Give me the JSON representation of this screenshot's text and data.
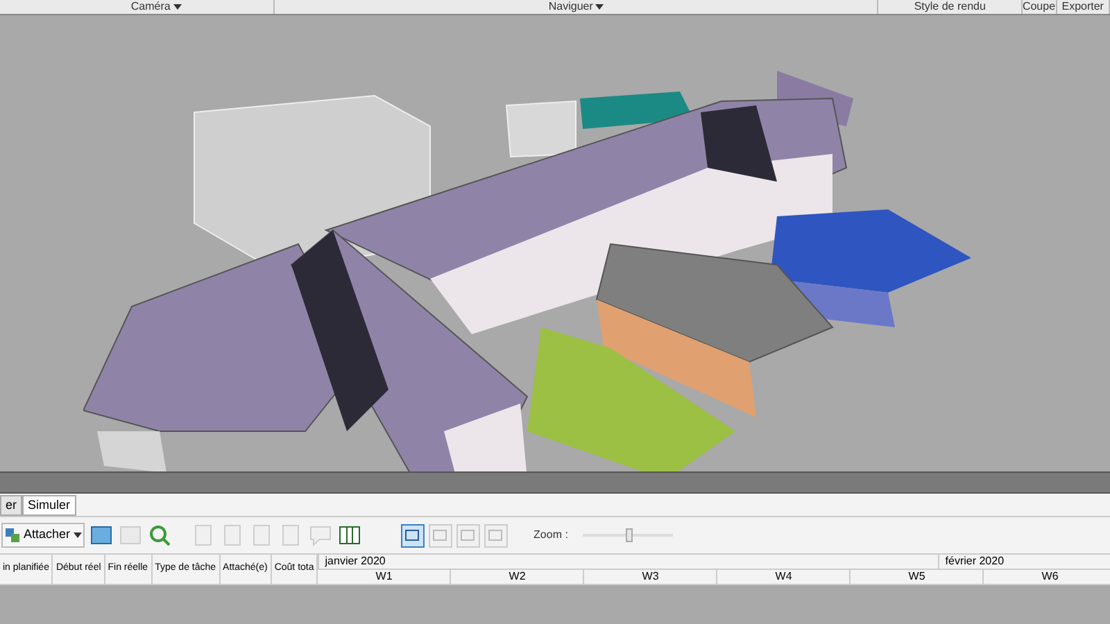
{
  "ribbon": {
    "groups": [
      {
        "label": "Caméra",
        "dropdown": true
      },
      {
        "label": "Naviguer",
        "dropdown": true
      },
      {
        "label": "Style de rendu",
        "dropdown": false
      },
      {
        "label": "Coupe",
        "dropdown": false
      },
      {
        "label": "Exporter",
        "dropdown": false
      }
    ]
  },
  "tabs": [
    {
      "label": "er",
      "selected": false
    },
    {
      "label": "Simuler",
      "selected": true
    }
  ],
  "toolbar": {
    "attach_button": "Attacher",
    "view_buttons": [
      {
        "selected": true
      },
      {
        "selected": false
      },
      {
        "selected": false
      },
      {
        "selected": false
      }
    ],
    "zoom_label": "Zoom :",
    "zoom": {
      "level": 0.5
    }
  },
  "table": {
    "columns": [
      "in planifiée",
      "Début réel",
      "Fin réelle",
      "Type de tâche",
      "Attaché(e)",
      "Coût tota"
    ]
  },
  "timeline": {
    "months": [
      "janvier 2020",
      "février 2020"
    ],
    "weeks": [
      "W1",
      "W2",
      "W3",
      "W4",
      "W5",
      "W6"
    ]
  }
}
